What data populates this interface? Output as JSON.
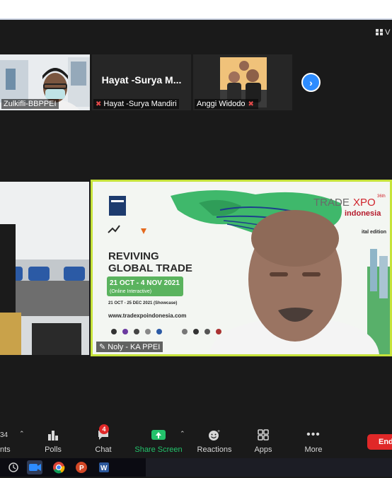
{
  "meeting": {
    "view_label": "V",
    "thumbnails": [
      {
        "name": "Zulkifli-BBPPEI",
        "big_name": ""
      },
      {
        "name": "Hayat -Surya Mandiri",
        "big_name": "Hayat -Surya M..."
      },
      {
        "name": "Anggi Widodo",
        "big_name": ""
      }
    ],
    "next_page_arrow": "chevron-right-icon",
    "active_speaker": {
      "name": "Noly - KA PPEI"
    },
    "slide": {
      "headline": [
        "REVIVING",
        "GLOBAL TRADE"
      ],
      "dates": "21 OCT - 4 NOV 2021",
      "online_label": "(Online Interactive)",
      "showcase": "21 OCT - 25 DEC 2021 (Showcase)",
      "url": "www.tradexpoindonesia.com",
      "brand_trade": "TRADE",
      "brand_xpo": "XPO",
      "brand_edition": "36th",
      "brand_country": "indonesia",
      "brand_sub": "ital edition"
    },
    "toolbar": {
      "participants_count": "34",
      "participants_label": "nts",
      "polls_label": "Polls",
      "chat_label": "Chat",
      "chat_badge": "4",
      "share_label": "Share Screen",
      "reactions_label": "Reactions",
      "apps_label": "Apps",
      "more_label": "More",
      "end_label": "End"
    },
    "colors": {
      "share_green": "#23c26b",
      "end_red": "#e02828",
      "speaker_border": "#c6e33a",
      "next_blue": "#2d8cff"
    }
  }
}
